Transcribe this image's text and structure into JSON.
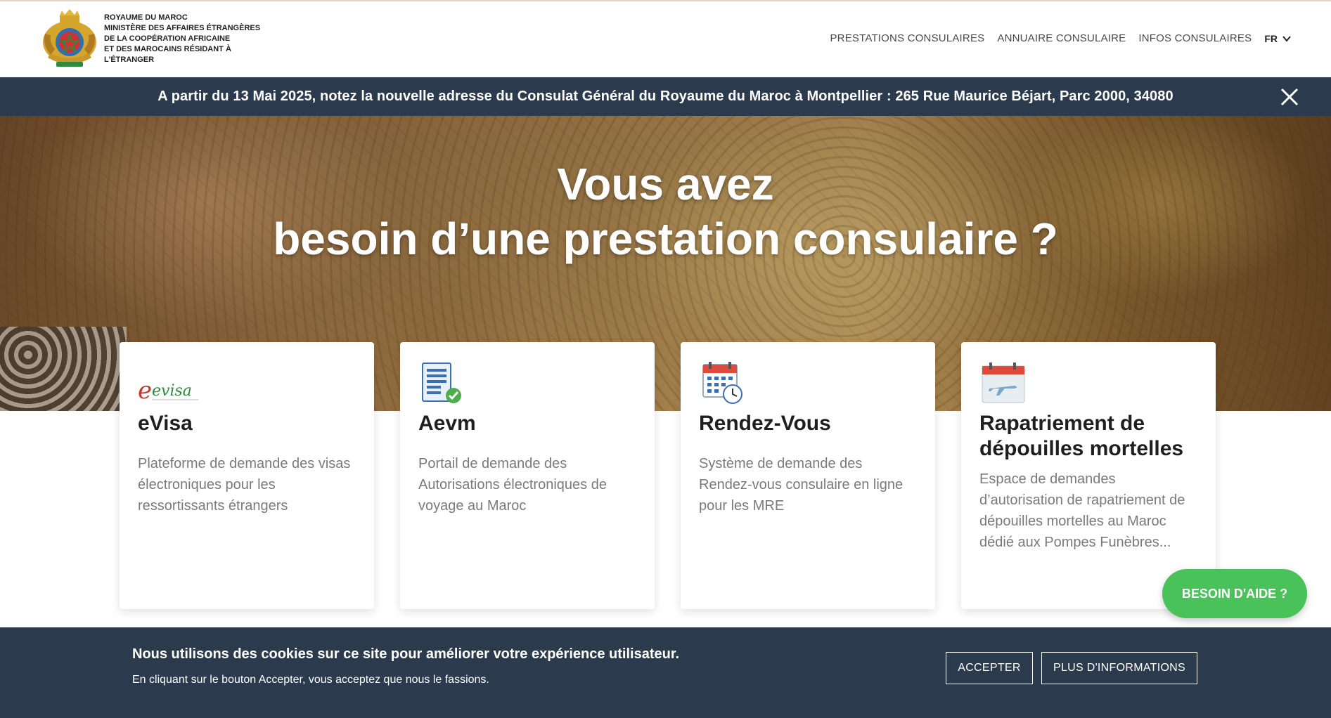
{
  "header": {
    "ministry_lines": [
      "ROYAUME DU MAROC",
      "MINISTÈRE DES AFFAIRES ÉTRANGÈRES",
      "DE LA COOPÉRATION AFRICAINE",
      "ET DES MAROCAINS RÉSIDANT À",
      "L'ÉTRANGER"
    ],
    "nav": [
      "PRESTATIONS CONSULAIRES",
      "ANNUAIRE CONSULAIRE",
      "INFOS CONSULAIRES"
    ],
    "lang": "FR"
  },
  "notice": {
    "text": "A partir du 13 Mai 2025, notez la nouvelle adresse du Consulat Général du Royaume du Maroc à Montpellier : 265 Rue Maurice Béjart, Parc 2000, 34080"
  },
  "hero": {
    "line1": "Vous avez",
    "line2": "besoin d’une prestation consulaire ?"
  },
  "cards": [
    {
      "title": "eVisa",
      "desc": "Plateforme de demande des visas électroniques pour les ressortissants étrangers",
      "icon": "evisa-logo",
      "logo_text": "evisa"
    },
    {
      "title": "Aevm",
      "desc": "Portail de demande des Autorisations électroniques de voyage au Maroc",
      "icon": "document-check-icon"
    },
    {
      "title": "Rendez-Vous",
      "desc": "Système de demande des Rendez-vous consulaire en ligne pour les MRE",
      "icon": "calendar-clock-icon"
    },
    {
      "title": "Rapatriement de dépouilles mortelles",
      "desc": "Espace de demandes d’autorisation de rapatriement de dépouilles mortelles au Maroc dédié aux Pompes Funèbres...",
      "icon": "calendar-plane-icon"
    }
  ],
  "help_button": "BESOIN D'AIDE ?",
  "cookie": {
    "title": "Nous utilisons des cookies sur ce site pour améliorer votre expérience utilisateur.",
    "subtitle": "En cliquant sur le bouton Accepter, vous acceptez que nous le fassions.",
    "accept": "ACCEPTER",
    "more_info": "PLUS D'INFORMATIONS"
  },
  "colors": {
    "navy": "#2c3a4e",
    "help_green": "#4ac25a"
  }
}
